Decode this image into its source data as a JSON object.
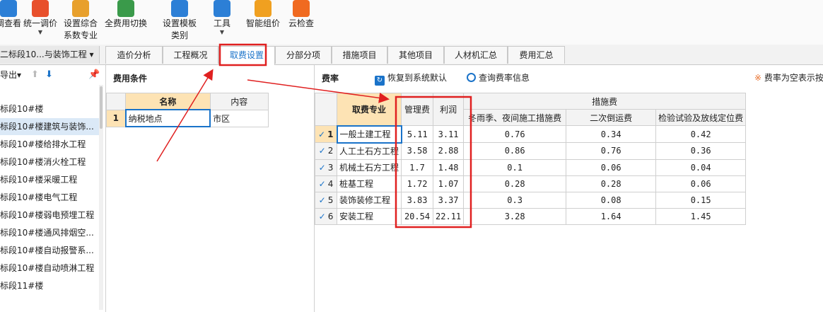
{
  "toolbar": {
    "buttons": [
      {
        "label1": "调查看",
        "label2": "",
        "arrow": false,
        "color": "#2c7fd6",
        "icon": "view-icon"
      },
      {
        "label1": "统一调价",
        "label2": "",
        "arrow": true,
        "color": "#e8502c",
        "icon": "price-adjust-icon"
      },
      {
        "label1": "设置综合",
        "label2": "系数专业",
        "arrow": false,
        "color": "#e8a02c",
        "icon": "coefficient-icon"
      },
      {
        "label1": "全费用切换",
        "label2": "",
        "arrow": false,
        "color": "#3a9a4a",
        "icon": "switch-icon"
      },
      {
        "label1": "设置模板",
        "label2": "类别",
        "arrow": false,
        "color": "#2c7fd6",
        "icon": "template-icon"
      },
      {
        "label1": "工具",
        "label2": "",
        "arrow": true,
        "color": "#2c7fd6",
        "icon": "tools-icon"
      },
      {
        "label1": "智能组价",
        "label2": "",
        "arrow": false,
        "color": "#f0a020",
        "icon": "smart-price-icon"
      },
      {
        "label1": "云检查",
        "label2": "",
        "arrow": false,
        "color": "#f06a20",
        "icon": "cloud-check-icon"
      }
    ]
  },
  "project_tab": "二标段10...与装饰工程 ▾",
  "tabs": [
    "造价分析",
    "工程概况",
    "取费设置",
    "分部分项",
    "措施项目",
    "其他项目",
    "人材机汇总",
    "费用汇总"
  ],
  "active_tab": "取费设置",
  "left": {
    "export_label": "导出▾",
    "tree": [
      "标段10#楼",
      "标段10#楼建筑与装饰...",
      "标段10#楼给排水工程",
      "标段10#楼消火栓工程",
      "标段10#楼采暖工程",
      "标段10#楼电气工程",
      "标段10#楼弱电预埋工程",
      "标段10#楼通风排烟空...",
      "标段10#楼自动报警系...",
      "标段10#楼自动喷淋工程",
      "标段11#楼"
    ]
  },
  "conditions": {
    "title": "费用条件",
    "headers": [
      "名称",
      "内容"
    ],
    "rows": [
      {
        "no": "1",
        "name": "纳税地点",
        "content": "市区"
      }
    ]
  },
  "rates": {
    "title": "费率",
    "restore_label": "恢复到系统默认",
    "query_label": "查询费率信息",
    "note": "费率为空表示按",
    "headers": {
      "profession": "取费专业",
      "management": "管理费",
      "profit": "利润",
      "measures": "措施费",
      "winter": "冬雨季、夜间施工措施费",
      "secondary": "二次倒运费",
      "inspection": "检验试验及放线定位费"
    },
    "rows": [
      {
        "no": "1",
        "name": "一般土建工程",
        "mgmt": "5.11",
        "profit": "3.11",
        "winter": "0.76",
        "secondary": "0.34",
        "inspect": "0.42"
      },
      {
        "no": "2",
        "name": "人工土石方工程",
        "mgmt": "3.58",
        "profit": "2.88",
        "winter": "0.86",
        "secondary": "0.76",
        "inspect": "0.36"
      },
      {
        "no": "3",
        "name": "机械土石方工程",
        "mgmt": "1.7",
        "profit": "1.48",
        "winter": "0.1",
        "secondary": "0.06",
        "inspect": "0.04"
      },
      {
        "no": "4",
        "name": "桩基工程",
        "mgmt": "1.72",
        "profit": "1.07",
        "winter": "0.28",
        "secondary": "0.28",
        "inspect": "0.06"
      },
      {
        "no": "5",
        "name": "装饰装修工程",
        "mgmt": "3.83",
        "profit": "3.37",
        "winter": "0.3",
        "secondary": "0.08",
        "inspect": "0.15"
      },
      {
        "no": "6",
        "name": "安装工程",
        "mgmt": "20.54",
        "profit": "22.11",
        "winter": "3.28",
        "secondary": "1.64",
        "inspect": "1.45"
      }
    ]
  },
  "colors": {
    "accent": "#1a73c9",
    "highlight": "#e02020",
    "header_orange": "#fde3b4"
  }
}
